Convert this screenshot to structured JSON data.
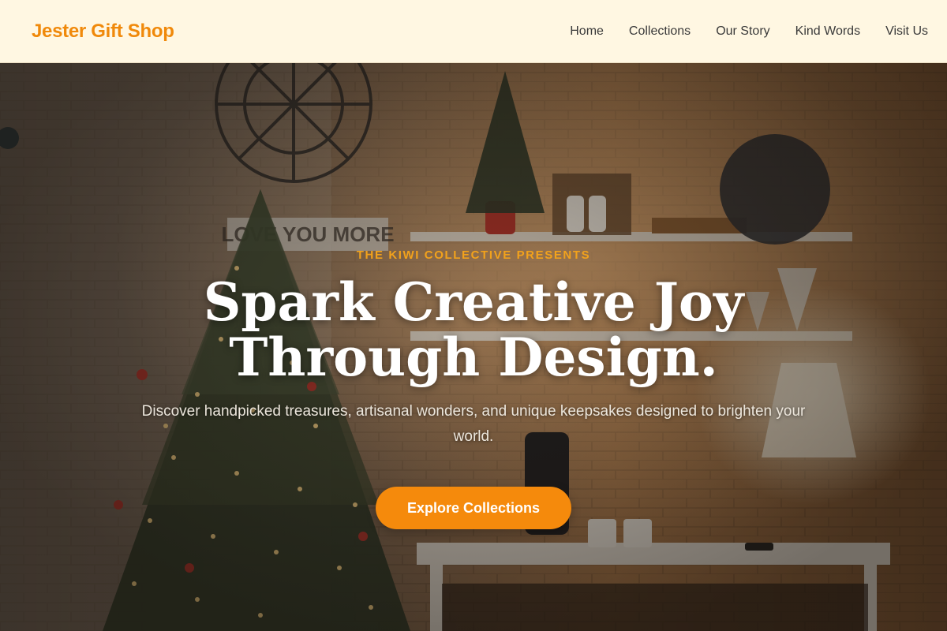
{
  "header": {
    "brand": "Jester Gift Shop",
    "nav": [
      {
        "label": "Home"
      },
      {
        "label": "Collections"
      },
      {
        "label": "Our Story"
      },
      {
        "label": "Kind Words"
      },
      {
        "label": "Visit Us"
      }
    ]
  },
  "hero": {
    "eyebrow": "THE KIWI COLLECTIVE PRESENTS",
    "headline": "Spark Creative Joy Through Design.",
    "subtext": "Discover handpicked treasures, artisanal wonders, and unique keepsakes designed to brighten your world.",
    "cta_label": "Explore Collections"
  },
  "colors": {
    "brand_orange": "#f0890a",
    "header_bg": "#fff7e2",
    "eyebrow": "#f2a21c",
    "cta_bg": "#f58a0c"
  }
}
